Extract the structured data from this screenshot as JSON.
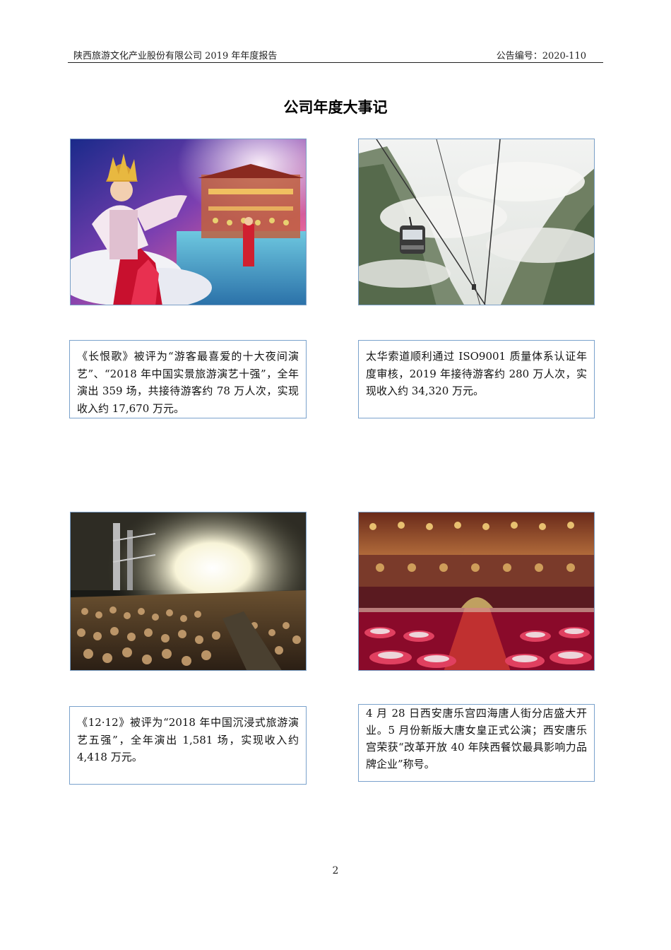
{
  "header": {
    "left": "陕西旅游文化产业股份有限公司 2019 年年度报告",
    "right": "公告编号：2020-110"
  },
  "title": "公司年度大事记",
  "captions": {
    "top_left": "《长恨歌》被评为“游客最喜爱的十大夜间演艺”、“2018 年中国实景旅游演艺十强”，全年演出 359 场，共接待游客约 78 万人次，实现收入约 17,670 万元。",
    "top_right": "太华索道顺利通过 ISO9001 质量体系认证年度审核，2019 年接待游客约 280  万人次，实现收入约 34,320 万元。",
    "bottom_left": "《12·12》被评为“2018 年中国沉浸式旅游演艺五强”，全年演出 1,581 场，实现收入约 4,418 万元。",
    "bottom_right": "4 月 28 日西安唐乐宫四海唐人街分店盛大开业。5 月份新版大唐女皇正式公演；西安唐乐宫荣获“改革开放 40 年陕西餐饮最具影响力品牌企业”称号。"
  },
  "page_number": "2",
  "colors": {
    "border": "#7aa2cc",
    "rule": "#222222"
  }
}
